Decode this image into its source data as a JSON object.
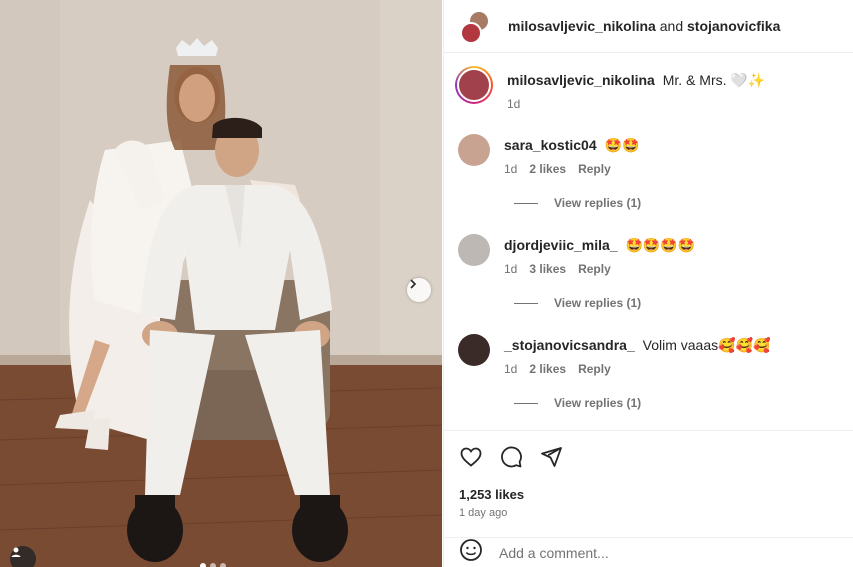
{
  "header": {
    "user1": "milosavljevic_nikolina",
    "and": "and",
    "user2": "stojanovicfika"
  },
  "caption": {
    "username": "milosavljevic_nikolina",
    "text": "Mr. & Mrs. 🤍✨",
    "time": "1d"
  },
  "comments": [
    {
      "username": "sara_kostic04",
      "text": "🤩🤩",
      "time": "1d",
      "likes": "2 likes",
      "reply": "Reply",
      "view_replies": "View replies (1)"
    },
    {
      "username": "djordjeviic_mila_",
      "text": "🤩🤩🤩🤩",
      "time": "1d",
      "likes": "3 likes",
      "reply": "Reply",
      "view_replies": "View replies (1)"
    },
    {
      "username": "_stojanovicsandra_",
      "text": "Volim vaaas🥰🥰🥰",
      "time": "1d",
      "likes": "2 likes",
      "reply": "Reply",
      "view_replies": "View replies (1)"
    }
  ],
  "post": {
    "likes": "1,253 likes",
    "time_ago": "1 day ago"
  },
  "add_comment": {
    "placeholder": "Add a comment..."
  },
  "icons": {
    "like": "heart-icon",
    "comment": "comment-bubble-icon",
    "share": "paper-plane-icon",
    "next": "chevron-right-icon",
    "tag": "user-tag-icon",
    "emoji": "smiley-icon"
  }
}
